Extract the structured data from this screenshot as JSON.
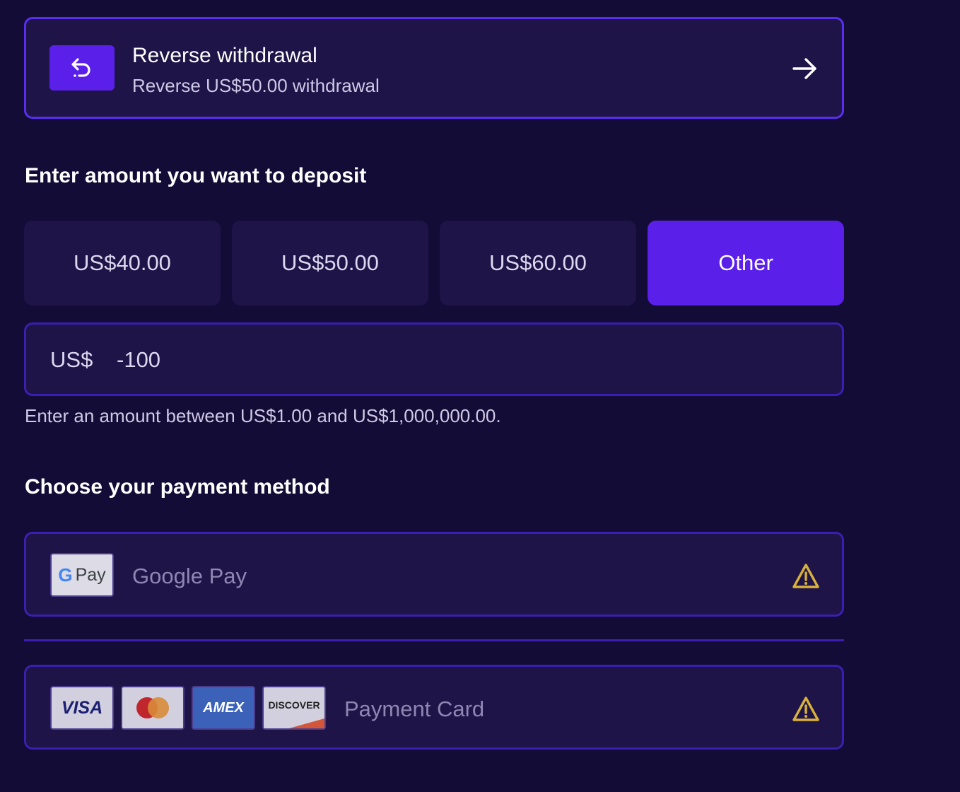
{
  "reverse": {
    "title": "Reverse withdrawal",
    "subtitle": "Reverse US$50.00 withdrawal",
    "icon": "undo-icon",
    "arrow_icon": "arrow-right-icon"
  },
  "deposit": {
    "heading": "Enter amount you want to deposit",
    "options": [
      {
        "label": "US$40.00",
        "selected": false
      },
      {
        "label": "US$50.00",
        "selected": false
      },
      {
        "label": "US$60.00",
        "selected": false
      },
      {
        "label": "Other",
        "selected": true
      }
    ],
    "currency_prefix": "US$",
    "amount_value": "-100",
    "hint": "Enter an amount between US$1.00 and US$1,000,000.00."
  },
  "payment": {
    "heading": "Choose your payment method",
    "methods": [
      {
        "label": "Google Pay",
        "logo_text": "Pay",
        "logo_g": "G",
        "status_icon": "warning-icon"
      },
      {
        "label": "Payment Card",
        "status_icon": "warning-icon",
        "card_logos": {
          "visa": "VISA",
          "amex": "AMEX",
          "discover": "DISCOVER"
        }
      }
    ]
  },
  "colors": {
    "background": "#130c36",
    "card": "#1e1448",
    "accent": "#5a20ea",
    "border": "#3a1fb0",
    "warning": "#d9b23c"
  }
}
